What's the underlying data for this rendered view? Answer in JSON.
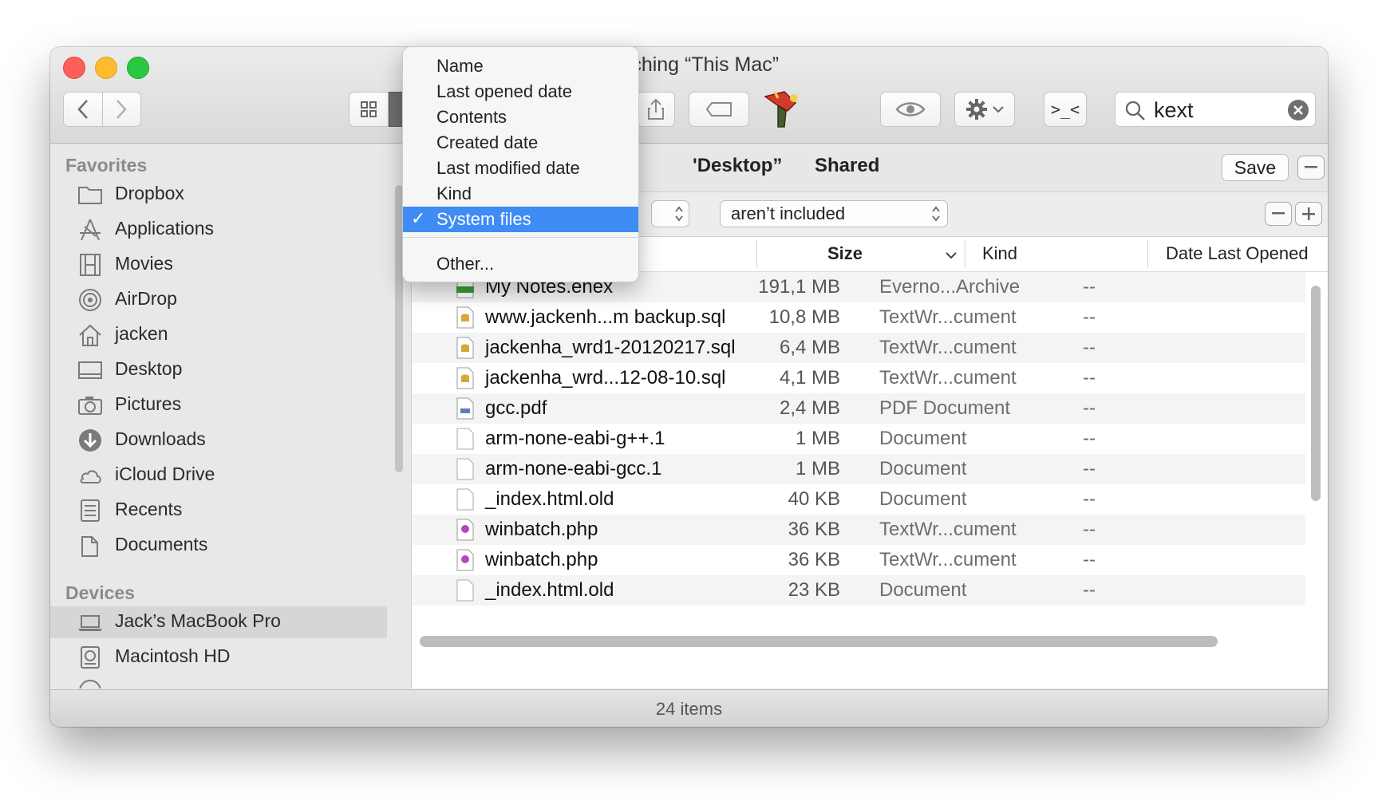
{
  "window": {
    "title": "Searching “This Mac”",
    "title_visible": "rching “This Mac”"
  },
  "toolbar": {
    "search_value": "kext",
    "terminal_label": ">_<"
  },
  "sidebar": {
    "favorites_header": "Favorites",
    "favorites": [
      {
        "label": "Dropbox",
        "icon": "folder-icon"
      },
      {
        "label": "Applications",
        "icon": "applications-icon"
      },
      {
        "label": "Movies",
        "icon": "film-icon"
      },
      {
        "label": "AirDrop",
        "icon": "airdrop-icon"
      },
      {
        "label": "jacken",
        "icon": "home-icon"
      },
      {
        "label": "Desktop",
        "icon": "desktop-icon"
      },
      {
        "label": "Pictures",
        "icon": "camera-icon"
      },
      {
        "label": "Downloads",
        "icon": "download-icon"
      },
      {
        "label": "iCloud Drive",
        "icon": "cloud-icon"
      },
      {
        "label": "Recents",
        "icon": "recents-icon"
      },
      {
        "label": "Documents",
        "icon": "documents-icon"
      }
    ],
    "devices_header": "Devices",
    "devices": [
      {
        "label": "Jack’s MacBook Pro",
        "icon": "laptop-icon",
        "selected": true
      },
      {
        "label": "Macintosh HD",
        "icon": "disk-icon"
      }
    ]
  },
  "scope": {
    "desktop_label": "“Desktop”",
    "desktop_visible": "'Desktop”",
    "shared_label": "Shared",
    "save_label": "Save"
  },
  "criteria": {
    "operator_value": "aren’t included"
  },
  "columns": {
    "size": "Size",
    "kind": "Kind",
    "date": "Date Last Opened"
  },
  "files": [
    {
      "name": "My Notes.enex",
      "size": "191,1 MB",
      "kind": "Everno...Archive",
      "date": "--",
      "icon": "enex"
    },
    {
      "name": "www.jackenh...m backup.sql",
      "size": "10,8 MB",
      "kind": "TextWr...cument",
      "date": "--",
      "icon": "sql"
    },
    {
      "name": "jackenha_wrd1-20120217.sql",
      "size": "6,4 MB",
      "kind": "TextWr...cument",
      "date": "--",
      "icon": "sql"
    },
    {
      "name": "jackenha_wrd...12-08-10.sql",
      "size": "4,1 MB",
      "kind": "TextWr...cument",
      "date": "--",
      "icon": "sql"
    },
    {
      "name": "gcc.pdf",
      "size": "2,4 MB",
      "kind": "PDF Document",
      "date": "--",
      "icon": "pdf"
    },
    {
      "name": "arm-none-eabi-g++.1",
      "size": "1 MB",
      "kind": "Document",
      "date": "--",
      "icon": "doc"
    },
    {
      "name": "arm-none-eabi-gcc.1",
      "size": "1 MB",
      "kind": "Document",
      "date": "--",
      "icon": "doc"
    },
    {
      "name": "_index.html.old",
      "size": "40 KB",
      "kind": "Document",
      "date": "--",
      "icon": "doc"
    },
    {
      "name": "winbatch.php",
      "size": "36 KB",
      "kind": "TextWr...cument",
      "date": "--",
      "icon": "php"
    },
    {
      "name": "winbatch.php",
      "size": "36 KB",
      "kind": "TextWr...cument",
      "date": "--",
      "icon": "php"
    },
    {
      "name": "_index.html.old",
      "size": "23 KB",
      "kind": "Document",
      "date": "--",
      "icon": "doc"
    }
  ],
  "status": {
    "items_count": "24 items"
  },
  "menu": {
    "items": [
      {
        "label": "Name"
      },
      {
        "label": "Last opened date"
      },
      {
        "label": "Contents"
      },
      {
        "label": "Created date"
      },
      {
        "label": "Last modified date"
      },
      {
        "label": "Kind"
      },
      {
        "label": "System files",
        "selected": true
      },
      {
        "label": "Other..."
      }
    ],
    "check_glyph": "✓"
  },
  "colors": {
    "selection": "#3f8cf5",
    "close": "#fc5f57",
    "minimize": "#fdbc2e",
    "zoom": "#28c840"
  }
}
